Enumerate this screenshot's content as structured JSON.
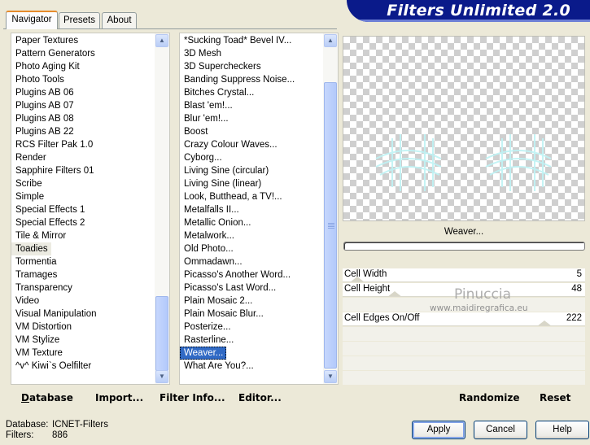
{
  "tabs": [
    {
      "label": "Navigator",
      "active": true
    },
    {
      "label": "Presets",
      "active": false
    },
    {
      "label": "About",
      "active": false
    }
  ],
  "app_title": "Filters Unlimited 2.0",
  "categories": {
    "items": [
      "Paper Textures",
      "Pattern Generators",
      "Photo Aging Kit",
      "Photo Tools",
      "Plugins AB 06",
      "Plugins AB 07",
      "Plugins AB 08",
      "Plugins AB 22",
      "RCS Filter Pak 1.0",
      "Render",
      "Sapphire Filters 01",
      "Scribe",
      "Simple",
      "Special Effects 1",
      "Special Effects 2",
      "Tile & Mirror",
      "Toadies",
      "Tormentia",
      "Tramages",
      "Transparency",
      "Video",
      "Visual Manipulation",
      "VM Distortion",
      "VM Stylize",
      "VM Texture",
      "^v^ Kiwi`s Oelfilter"
    ],
    "selected": "Toadies"
  },
  "filters": {
    "items": [
      "*Sucking Toad*  Bevel IV...",
      "3D Mesh",
      "3D Supercheckers",
      "Banding Suppress Noise...",
      "Bitches Crystal...",
      "Blast 'em!...",
      "Blur 'em!...",
      "Boost",
      "Crazy Colour Waves...",
      "Cyborg...",
      "Living Sine (circular)",
      "Living Sine (linear)",
      "Look, Butthead, a TV!...",
      "Metalfalls II...",
      "Metallic Onion...",
      "Metalwork...",
      "Old Photo...",
      "Ommadawn...",
      "Picasso's Another Word...",
      "Picasso's Last Word...",
      "Plain Mosaic 2...",
      "Plain Mosaic Blur...",
      "Posterize...",
      "Rasterline...",
      "Weaver...",
      "What Are You?..."
    ],
    "selected": "Weaver..."
  },
  "preview": {
    "filter_name": "Weaver...",
    "progress": 0
  },
  "params": [
    {
      "name": "Cell Width",
      "value": "5",
      "level": 0.02
    },
    {
      "name": "Cell Height",
      "value": "48",
      "level": 0.19
    },
    {
      "name": "",
      "value": ""
    },
    {
      "name": "Cell Edges On/Off",
      "value": "222",
      "level": 0.87
    },
    {
      "name": "",
      "value": ""
    },
    {
      "name": "",
      "value": ""
    },
    {
      "name": "",
      "value": ""
    },
    {
      "name": "",
      "value": ""
    }
  ],
  "bottom_left_buttons": [
    {
      "label": "Database",
      "accel": "D"
    },
    {
      "label": "Import...",
      "accel": "I"
    },
    {
      "label": "Filter Info...",
      "accel": "I"
    },
    {
      "label": "Editor...",
      "accel": "E"
    }
  ],
  "bottom_right_buttons": [
    {
      "label": "Randomize"
    },
    {
      "label": "Reset"
    }
  ],
  "status": {
    "database_label": "Database:",
    "database_value": "ICNET-Filters",
    "filters_label": "Filters:",
    "filters_value": "886"
  },
  "dialog_buttons": {
    "apply": "Apply",
    "cancel": "Cancel",
    "help": "Help"
  },
  "watermark": {
    "name": "Pinuccia",
    "site": "www.maidiregrafica.eu"
  }
}
